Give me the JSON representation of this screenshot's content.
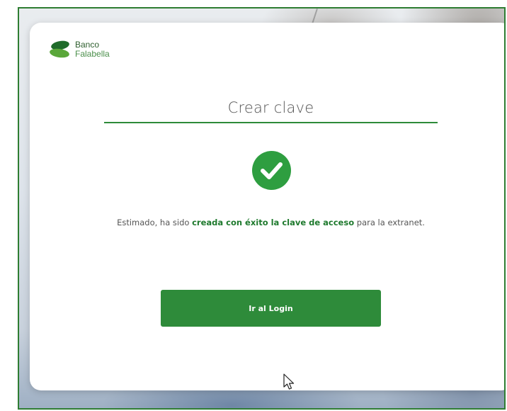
{
  "brand": {
    "line1": "Banco",
    "line2": "Falabella",
    "colors": {
      "primary": "#2e8b3a",
      "dark": "#2f5f2f",
      "light": "#4b8f4b"
    }
  },
  "card": {
    "title": "Crear clave",
    "icon": "check-circle-icon",
    "message": {
      "prefix": "Estimado, ha sido ",
      "highlight": "creada con éxito la clave de acceso",
      "suffix": " para la extranet."
    },
    "button_label": "Ir al Login"
  },
  "cursor": {
    "icon": "mouse-pointer-icon"
  }
}
